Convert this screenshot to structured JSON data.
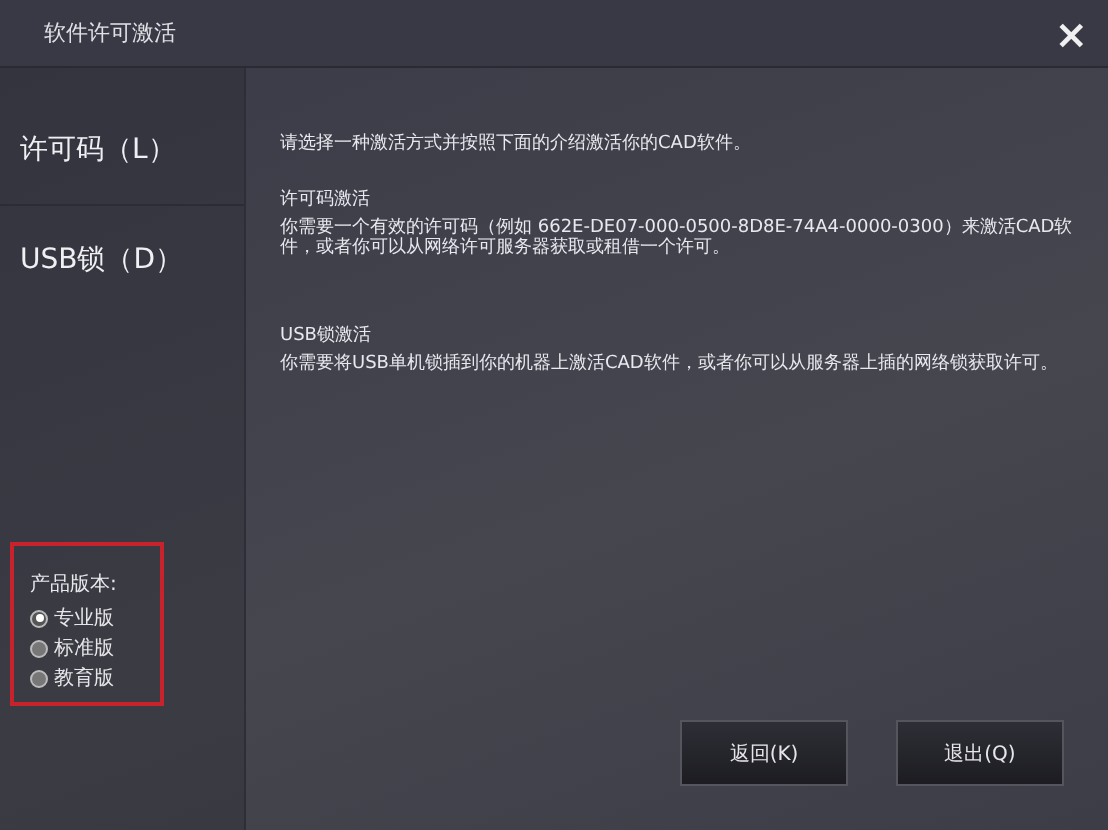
{
  "window": {
    "title": "软件许可激活",
    "close": "×"
  },
  "sidebar": {
    "items": [
      {
        "label": "许可码（L）"
      },
      {
        "label": "USB锁（D）"
      }
    ]
  },
  "content": {
    "intro": "请选择一种激活方式并按照下面的介绍激活你的CAD软件。",
    "sections": [
      {
        "heading": "许可码激活",
        "body": "你需要一个有效的许可码（例如 662E-DE07-000-0500-8D8E-74A4-0000-0300）来激活CAD软件，或者你可以从网络许可服务器获取或租借一个许可。"
      },
      {
        "heading": "USB锁激活",
        "body": "你需要将USB单机锁插到你的机器上激活CAD软件，或者你可以从服务器上插的网络锁获取许可。"
      }
    ]
  },
  "edition": {
    "label": "产品版本:",
    "options": [
      {
        "label": "专业版",
        "selected": true
      },
      {
        "label": "标准版",
        "selected": false
      },
      {
        "label": "教育版",
        "selected": false
      }
    ]
  },
  "buttons": [
    "返回(K)",
    "退出(Q)"
  ]
}
